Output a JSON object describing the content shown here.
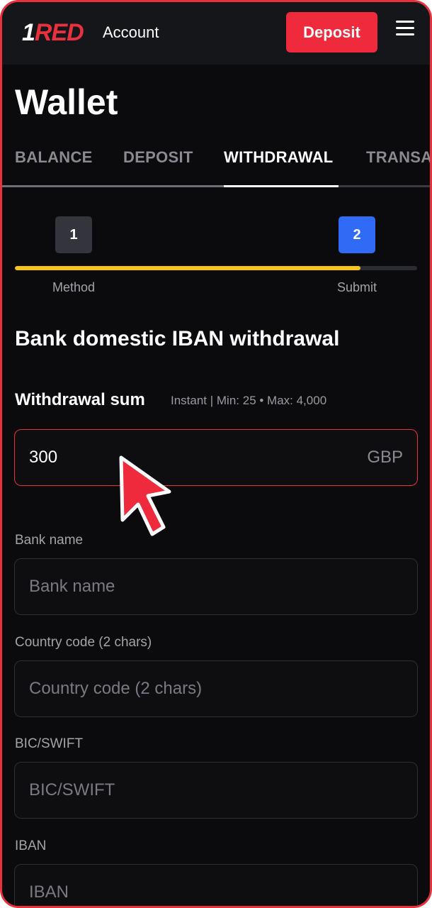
{
  "header": {
    "logo": {
      "prefix": "1",
      "text": "RED"
    },
    "account_label": "Account",
    "deposit_label": "Deposit",
    "menu_icon": "hamburger-menu-icon"
  },
  "page": {
    "title": "Wallet"
  },
  "tabs": [
    {
      "label": "BALANCE",
      "active": false
    },
    {
      "label": "DEPOSIT",
      "active": false
    },
    {
      "label": "WITHDRAWAL",
      "active": true
    },
    {
      "label": "TRANSACTIONS",
      "active": false
    }
  ],
  "stepper": {
    "steps": [
      {
        "number": "1",
        "label": "Method"
      },
      {
        "number": "2",
        "label": "Submit"
      }
    ],
    "progress_percent": 86,
    "colors": {
      "progress": "#f5c518",
      "current_step": "#2f6bf5",
      "done_step": "#34353c"
    }
  },
  "form": {
    "title": "Bank domestic IBAN withdrawal",
    "sum": {
      "label": "Withdrawal sum",
      "hint": "Instant | Min: 25 • Max: 4,000",
      "value": "300",
      "currency": "GBP"
    },
    "fields": [
      {
        "label": "Bank name",
        "placeholder": "Bank name"
      },
      {
        "label": "Country code (2 chars)",
        "placeholder": "Country code (2 chars)"
      },
      {
        "label": "BIC/SWIFT",
        "placeholder": "BIC/SWIFT"
      },
      {
        "label": "IBAN",
        "placeholder": "IBAN"
      }
    ]
  },
  "colors": {
    "accent": "#ee2a3c",
    "background": "#0b0b0e",
    "header": "#15161a"
  },
  "overlay": {
    "pointer_icon": "mouse-pointer-arrow-icon"
  }
}
